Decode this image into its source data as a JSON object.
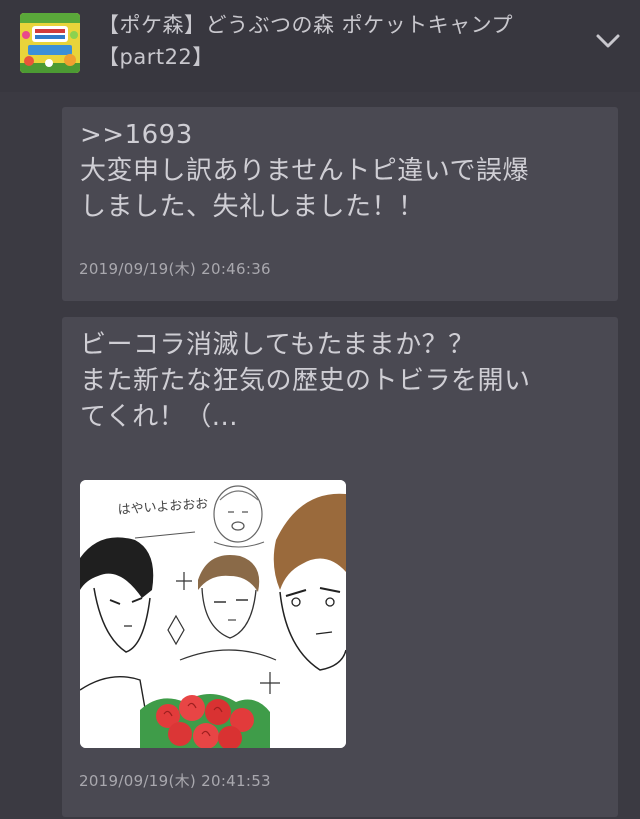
{
  "header": {
    "title": "【ポケ森】どうぶつの森 ポケットキャンプ\n【part22】",
    "thumbnail_icon": "animal-crossing-thumbnail",
    "expand_icon": "chevron-down-icon"
  },
  "posts": [
    {
      "text": ">>1693\n大変申し訳ありませんトピ違いで誤爆\nしました、失礼しました！！",
      "date": "2019/09/19(木) 20:46:36"
    },
    {
      "text": "ビーコラ消滅してもたままか？？\nまた新たな狂気の歴史のトビラを開い\nてくれ！（...",
      "image_caption": "はやいよおおお",
      "date": "2019/09/19(木) 20:41:53"
    }
  ],
  "colors": {
    "background": "#3b3a42",
    "card": "#4a4952",
    "text": "#cfced4",
    "date": "#a9a8ae"
  }
}
